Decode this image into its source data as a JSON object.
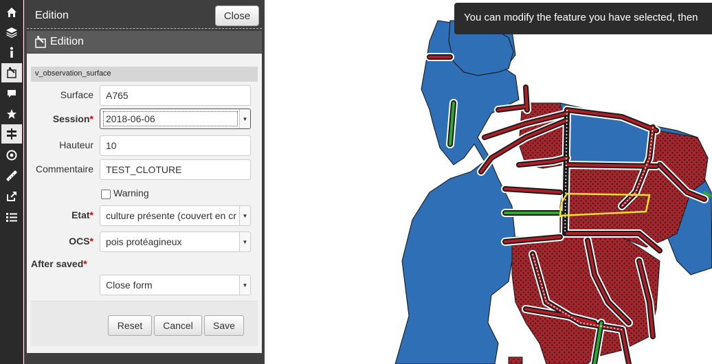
{
  "dock": {
    "title": "Edition",
    "close_label": "Close",
    "subtitle": "Edition"
  },
  "form": {
    "layer_name": "v_observation_surface",
    "surface": {
      "label": "Surface",
      "value": "A765"
    },
    "session": {
      "label": "Session",
      "required_mark": "*",
      "value": "2018-06-06"
    },
    "hauteur": {
      "label": "Hauteur",
      "value": "10"
    },
    "commentaire": {
      "label": "Commentaire",
      "value": "TEST_CLOTURE"
    },
    "warning": {
      "label": "Warning",
      "checked": false
    },
    "etat": {
      "label": "Etat",
      "required_mark": "*",
      "value": "culture présente (couvert en cr"
    },
    "ocs": {
      "label": "OCS",
      "required_mark": "*",
      "value": "pois protéagineux"
    },
    "after_saved": {
      "label": "After saved",
      "required_mark": "*",
      "value": "Close form"
    }
  },
  "buttons": {
    "reset": "Reset",
    "cancel": "Cancel",
    "save": "Save"
  },
  "map": {
    "tooltip": "You can modify the feature you have selected, then"
  },
  "rail": {
    "icons": [
      "home-icon",
      "layers-icon",
      "info-icon",
      "edition-icon",
      "comment-icon",
      "star-icon",
      "signpost-icon",
      "locate-icon",
      "measure-icon",
      "share-icon",
      "list-icon"
    ]
  },
  "colors": {
    "accent": "#7a1f3a",
    "parcel_blue": "#2e6fb5",
    "parcel_red": "#a4262c",
    "selection_yellow": "#f2e02a",
    "border_green": "#2fa836"
  }
}
